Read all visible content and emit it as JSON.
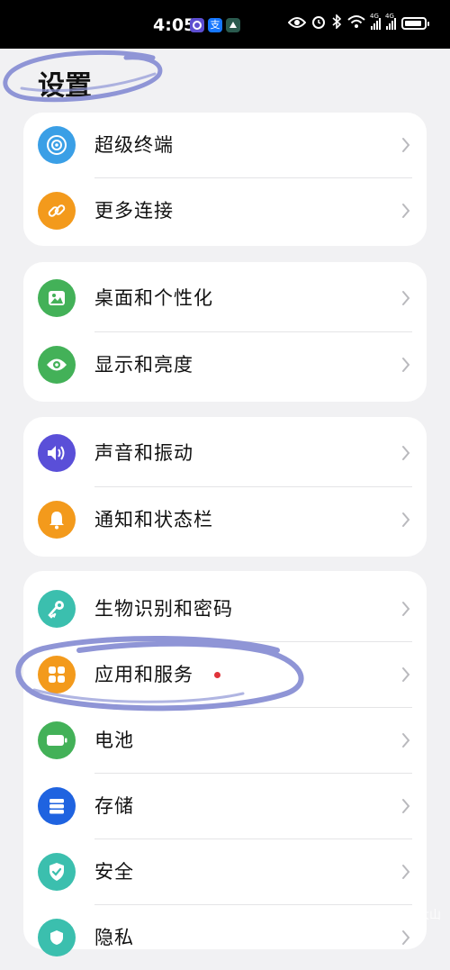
{
  "status_bar": {
    "time": "4:05",
    "app_icons": [
      "tiktok-icon",
      "alipay-icon",
      "app-icon"
    ],
    "alipay_glyph": "支",
    "indicators": [
      "eye-icon",
      "alarm-icon",
      "bluetooth-icon",
      "wifi-icon",
      "signal-4g-icon",
      "signal-4g-icon",
      "battery-icon"
    ],
    "signal_tag": "4G",
    "battery_level": 0.9
  },
  "header": {
    "title": "设置"
  },
  "groups": [
    {
      "items": [
        {
          "label": "超级终端",
          "icon": "super-device-icon",
          "color": "#3a9fe6"
        },
        {
          "label": "更多连接",
          "icon": "link-icon",
          "color": "#f39a1c"
        }
      ]
    },
    {
      "items": [
        {
          "label": "桌面和个性化",
          "icon": "wallpaper-icon",
          "color": "#43b158"
        },
        {
          "label": "显示和亮度",
          "icon": "eye-icon",
          "color": "#43b158"
        }
      ]
    },
    {
      "items": [
        {
          "label": "声音和振动",
          "icon": "speaker-icon",
          "color": "#5a4fd8"
        },
        {
          "label": "通知和状态栏",
          "icon": "bell-icon",
          "color": "#f39a1c"
        }
      ]
    },
    {
      "items": [
        {
          "label": "生物识别和密码",
          "icon": "key-icon",
          "color": "#3bbfae"
        },
        {
          "label": "应用和服务",
          "icon": "apps-icon",
          "color": "#f39a1c",
          "badge": "red-dot"
        },
        {
          "label": "电池",
          "icon": "battery-icon",
          "color": "#43b158"
        },
        {
          "label": "存储",
          "icon": "storage-icon",
          "color": "#1f63e0"
        },
        {
          "label": "安全",
          "icon": "shield-icon",
          "color": "#3bbfae"
        },
        {
          "label": "隐私",
          "icon": "privacy-icon",
          "color": "#3bbfae"
        }
      ]
    }
  ],
  "watermark": "⚇@藏在云雾之中的大山",
  "colors": {
    "background": "#f1f1f3",
    "scribble": "#8f95d6",
    "badge": "#e0333a"
  }
}
